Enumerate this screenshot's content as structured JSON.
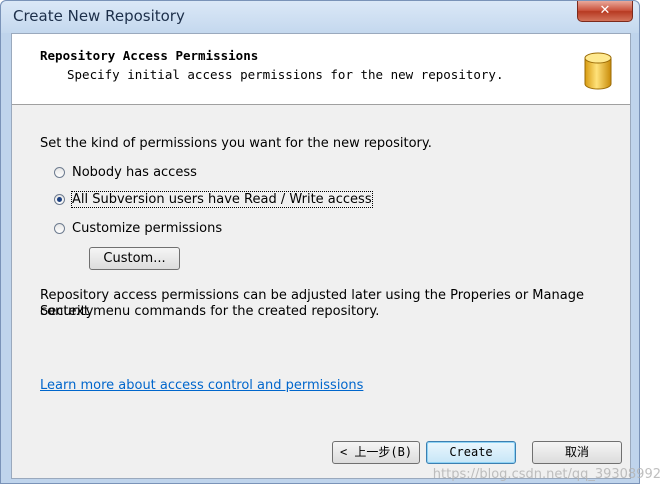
{
  "window": {
    "title": "Create New Repository",
    "close_label": "✕"
  },
  "header": {
    "title": "Repository Access Permissions",
    "subtitle": "Specify initial access permissions for the new repository.",
    "icon": "database-cylinder-icon"
  },
  "main": {
    "prompt": "Set the kind of permissions you want for the new repository.",
    "options": [
      {
        "label": "Nobody has access",
        "checked": false
      },
      {
        "label": "All Subversion users have Read / Write access",
        "checked": true
      },
      {
        "label": "Customize permissions",
        "checked": false
      }
    ],
    "custom_button": "Custom...",
    "note_line1": "Repository access permissions can be adjusted later using the Properies or Manage Security",
    "note_line2": "context menu commands for the created repository.",
    "link": "Learn more about access control and permissions"
  },
  "footer": {
    "back_button": "< 上一步(B)",
    "create_button": "Create",
    "cancel_button": "取消"
  },
  "watermark": "https://blog.csdn.net/qq_39308992",
  "colors": {
    "link": "#0066cc",
    "titlebar": "#c4d8ee",
    "close_button": "#c9513b",
    "icon_gold": "#f2c12e"
  }
}
